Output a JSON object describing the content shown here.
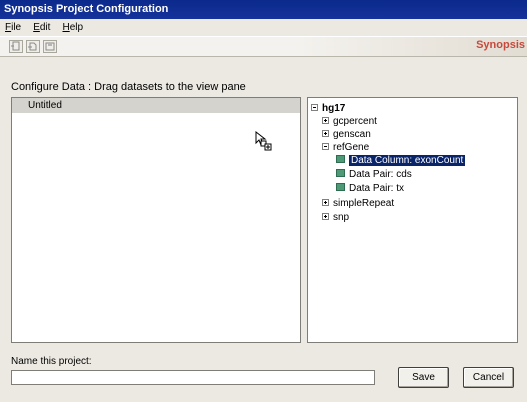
{
  "window": {
    "title": "Synopsis Project Configuration"
  },
  "menu": [
    {
      "letter": "F",
      "rest": "ile"
    },
    {
      "letter": "E",
      "rest": "dit"
    },
    {
      "letter": "H",
      "rest": "elp"
    }
  ],
  "toolbar": {
    "buttons": [
      "new-project-icon",
      "open-project-icon",
      "save-project-icon"
    ],
    "brand": "Synopsis"
  },
  "instruction": "Configure Data : Drag datasets to the view pane",
  "view_pane": {
    "items": [
      {
        "label": "Untitled",
        "selected": true
      }
    ]
  },
  "tree": {
    "root": "hg17",
    "nodes": [
      {
        "label": "gcpercent",
        "expanded": false
      },
      {
        "label": "genscan",
        "expanded": false
      },
      {
        "label": "refGene",
        "expanded": true,
        "children": [
          {
            "label": "Data Column: exonCount",
            "selected": true
          },
          {
            "label": "Data Pair: cds",
            "selected": false
          },
          {
            "label": "Data Pair: tx",
            "selected": false
          }
        ]
      },
      {
        "label": "simpleRepeat",
        "expanded": false
      },
      {
        "label": "snp",
        "expanded": false
      }
    ]
  },
  "project_name": {
    "label": "Name this project:",
    "value": ""
  },
  "buttons": {
    "save": "Save",
    "cancel": "Cancel"
  },
  "colors": {
    "title_bar": "#0b2a8c",
    "selection": "#0a246a",
    "brand": "#c64a3c",
    "leaf_icon": "#4f9a76"
  }
}
